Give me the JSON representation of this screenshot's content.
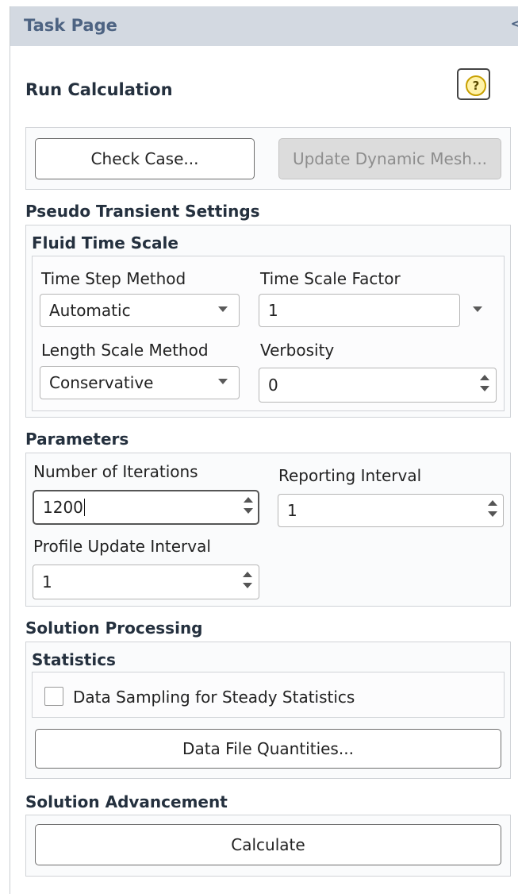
{
  "header": {
    "title": "Task Page",
    "collapse_glyph": "<"
  },
  "page_title": "Run Calculation",
  "help": {
    "glyph": "?"
  },
  "top_buttons": {
    "check_case": "Check Case...",
    "update_dynamic_mesh": "Update Dynamic Mesh..."
  },
  "pseudo_transient": {
    "title": "Pseudo Transient Settings",
    "fluid_time_scale": {
      "title": "Fluid Time Scale",
      "time_step_method_label": "Time Step Method",
      "time_step_method_value": "Automatic",
      "time_scale_factor_label": "Time Scale Factor",
      "time_scale_factor_value": "1",
      "length_scale_method_label": "Length Scale Method",
      "length_scale_method_value": "Conservative",
      "verbosity_label": "Verbosity",
      "verbosity_value": "0"
    }
  },
  "parameters": {
    "title": "Parameters",
    "num_iterations_label": "Number of Iterations",
    "num_iterations_value": "1200",
    "reporting_interval_label": "Reporting Interval",
    "reporting_interval_value": "1",
    "profile_update_label": "Profile Update Interval",
    "profile_update_value": "1"
  },
  "solution_processing": {
    "title": "Solution Processing",
    "statistics_title": "Statistics",
    "data_sampling_label": "Data Sampling for Steady Statistics",
    "data_sampling_checked": false,
    "data_file_quantities": "Data File Quantities..."
  },
  "solution_advancement": {
    "title": "Solution Advancement",
    "calculate": "Calculate"
  },
  "colors": {
    "header_bg": "#d3d9e1",
    "header_text": "#4d6382",
    "help_icon": "#fff2a8"
  }
}
